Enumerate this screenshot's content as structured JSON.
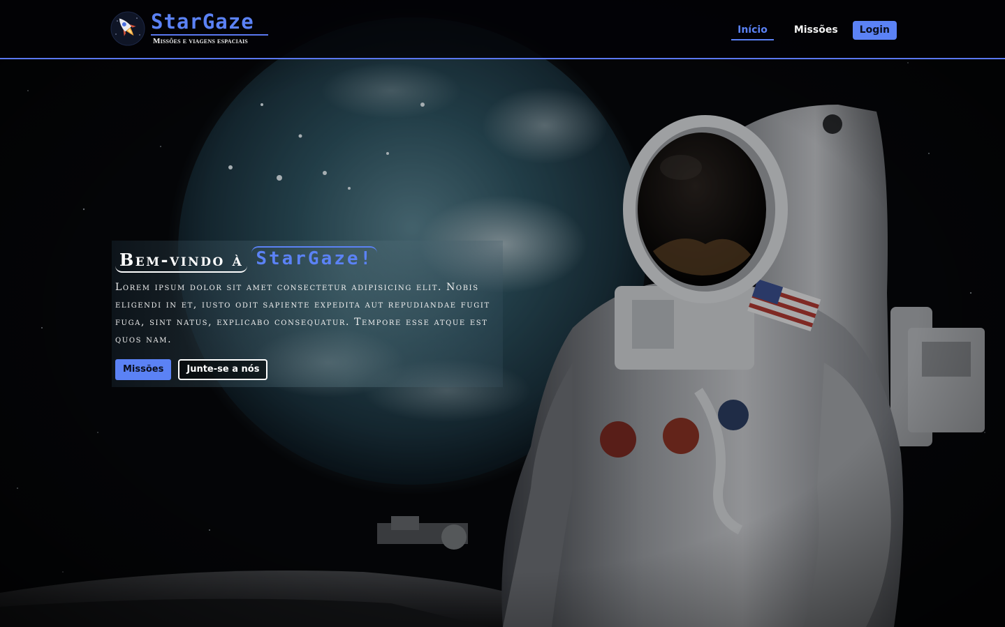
{
  "brand": {
    "title": "StarGaze",
    "subtitle": "Missões e viagens espaciais",
    "accent_color": "#5b82f5",
    "logo_icon": "rocket-icon"
  },
  "nav": {
    "items": [
      {
        "label": "Início",
        "active": true
      },
      {
        "label": "Missões",
        "active": false
      }
    ],
    "login_label": "Login"
  },
  "hero": {
    "welcome_prefix": "Bem-vindo à",
    "welcome_brand": "StarGaze!",
    "description": "Lorem ipsum dolor sit amet consectetur adipisicing elit. Nobis eligendi in et, iusto odit sapiente expedita aut repudiandae fugit fuga, sint natus, explicabo consequatur. Tempore esse atque est quos nam.",
    "primary_button": "Missões",
    "secondary_button": "Junte-se a nós",
    "background_image": "astronaut-moon-image"
  }
}
